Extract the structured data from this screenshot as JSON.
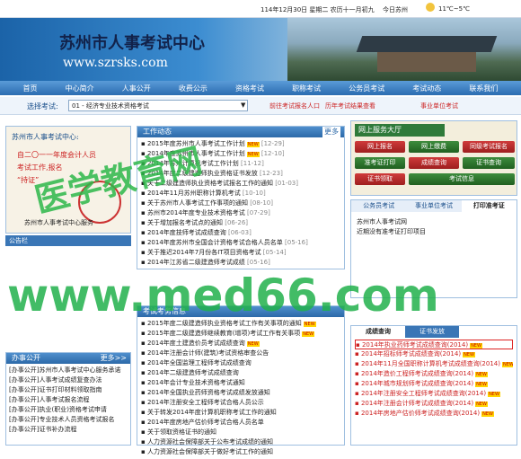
{
  "top": {
    "datetime": "114年12月30日 星期二 农历十一月初九",
    "today": "今日苏州",
    "weather": "11℃~5℃"
  },
  "banner": {
    "title": "苏州市人事考试中心",
    "url": "www.szrsks.com"
  },
  "nav": [
    "首页",
    "中心简介",
    "人事公开",
    "收费公示",
    "资格考试",
    "职称考试",
    "公务员考试",
    "考试动态",
    "联系我们"
  ],
  "select": {
    "label": "选择考试:",
    "value": "01 - 经济专业技术资格考试",
    "tips": [
      "前往考试报名人口",
      "历年考试结果查看"
    ],
    "extra": "事业单位考试"
  },
  "notice": {
    "title": "苏州市人事考试中心:",
    "lines": [
      "自二〇一一年度会计人员",
      "考试工作,报名",
      "“持证”"
    ],
    "caption": "苏州市人事考试中心服务"
  },
  "leftbar": {
    "label": "公告栏"
  },
  "news": {
    "title": "工作动态",
    "more": "更多",
    "items": [
      {
        "t": "2015年度苏州市人事考试工作计划",
        "d": "[12-29]",
        "n": true
      },
      {
        "t": "2014年度苏州市人事考试工作计划",
        "d": "[12-10]",
        "n": true
      },
      {
        "t": "2014年苏州计算机考试工作计划",
        "d": "[11-12]"
      },
      {
        "t": "2014年度二级建造师执业资格证书发放",
        "d": "[12-23]"
      },
      {
        "t": "关于二级建造师执业资格考试报名工作的通知",
        "d": "[01-03]"
      },
      {
        "t": "2014年11月苏州职称计算机考试",
        "d": "[10-10]"
      },
      {
        "t": "关于苏州市人事考试工作事项的通知",
        "d": "[08-10]"
      },
      {
        "t": "苏州市2014年度专业技术资格考试",
        "d": "[07-29]"
      },
      {
        "t": "关于增加报名考试点的通知",
        "d": "[06-26]"
      },
      {
        "t": "2014年度技师考试成绩查询",
        "d": "[06-03]"
      },
      {
        "t": "2014年度苏州市全国会计资格考试合格人员名单",
        "d": "[05-16]"
      },
      {
        "t": "关于推迟2014年7月份各IT项目资格考试",
        "d": "[05-14]"
      },
      {
        "t": "2014年江苏省二级建造师考试成绩",
        "d": "[05-16]"
      }
    ]
  },
  "publish": {
    "title": "网上服务大厅",
    "buttons": [
      "网上报名",
      "网上缴费",
      "同级考试报名",
      "准考证打印",
      "成绩查询",
      "证书查询",
      "证书领取",
      "考试信息"
    ]
  },
  "tabs2": [
    "公务员考试",
    "事业单位考试",
    "打印准考证"
  ],
  "tab2body": [
    "苏州市人事考试网",
    "近期没有准考证打印项目"
  ],
  "scores": {
    "tabs": [
      "成绩查询",
      "证书发放"
    ],
    "items": [
      "2014年执业药师考试成绩查询(2014)",
      "2014年招标师考试成绩查询(2014)",
      "2014年11月全国职称计算机考试成绩查询(2014)",
      "2014年造价工程师考试成绩查询(2014)",
      "2014年城市规划师考试成绩查询(2014)",
      "2014年注册安全工程师考试成绩查询(2014)",
      "2014年注册会计师考试成绩查询(2014)",
      "2014年房地产估价师考试成绩查询(2014)"
    ]
  },
  "exam": {
    "title": "考试考务信息",
    "items": [
      "2015年度二级建造师执业资格考试工作有关事项的通知",
      "2015年度二级建造师继续教育(增项)考试工作有关事项",
      "2014年度土建造价员考试成绩查询",
      "2014年注册会计师(建筑)考试资格审查公告",
      "2014年全国监理工程师考试成绩查询",
      "2014年二级建造师考试成绩查询",
      "2014年会计专业技术资格考试通知",
      "2014年全国执业药师资格考试成绩发放通知",
      "2014年注册安全工程师考试合格人员公示",
      "关于转发2014年度计算机职称考试工作的通知",
      "2014年度房地产估价师考试合格人员名单",
      "关于领取资格证书的通知",
      "人力资源社会保障部关于公布考试成绩的通知",
      "人力资源社会保障部关于做好考试工作的通知"
    ]
  },
  "left2": {
    "title": "办事公开",
    "more": "更多>>",
    "items": [
      "[办事公开]苏州市人事考试中心服务承诺",
      "[办事公开]人事考试成绩复查办法",
      "[办事公开]证书打印材料领取指南",
      "[办事公开]人事考试报名流程",
      "[办事公开]执业(职业)资格考试申请",
      "[办事公开]专业技术人员资格考试报名",
      "[办事公开]证书补办流程"
    ]
  },
  "watermarks": [
    "医学教育网",
    "www.med66.com"
  ],
  "colors": {
    "nav": "#2b6cb0",
    "watermark": "#22b14c",
    "highlight": "#cc2222"
  }
}
